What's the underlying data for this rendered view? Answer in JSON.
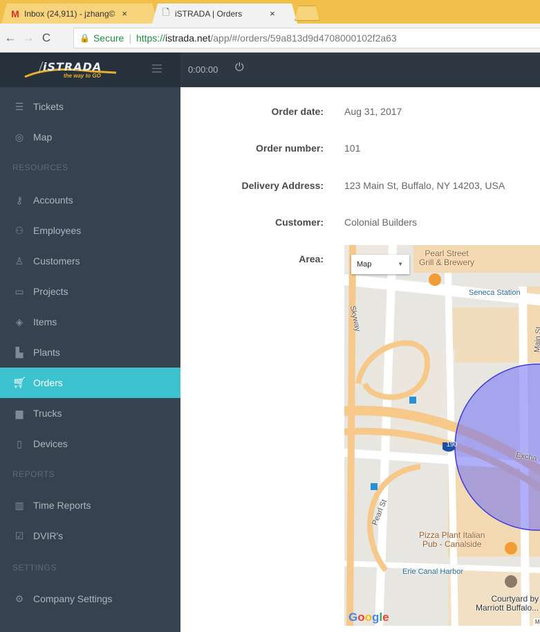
{
  "browser": {
    "tabs": [
      {
        "icon": "gmail-icon",
        "title": "Inbox (24,911) - jzhang©",
        "close": "×"
      },
      {
        "icon": "page-icon",
        "title": "iSTRADA | Orders",
        "close": "×"
      }
    ],
    "secure_label": "Secure",
    "url": {
      "scheme": "https://",
      "host": "istrada.net",
      "path": "/app/#/orders/59a813d9d4708000102f2a63"
    }
  },
  "app": {
    "logo_text": "iSTRADA",
    "logo_tagline": "the way to GO",
    "timer": "0:00:00"
  },
  "sidebar": {
    "items": [
      {
        "label": "Tickets",
        "icon": "layers-icon"
      },
      {
        "label": "Map",
        "icon": "map-pin-icon"
      },
      {
        "label": "Accounts",
        "icon": "key-icon"
      },
      {
        "label": "Employees",
        "icon": "users-icon"
      },
      {
        "label": "Customers",
        "icon": "user-icon"
      },
      {
        "label": "Projects",
        "icon": "folder-icon"
      },
      {
        "label": "Items",
        "icon": "box-icon"
      },
      {
        "label": "Plants",
        "icon": "factory-icon"
      },
      {
        "label": "Orders",
        "icon": "cart-icon",
        "active": true
      },
      {
        "label": "Trucks",
        "icon": "truck-icon"
      },
      {
        "label": "Devices",
        "icon": "phone-icon"
      },
      {
        "label": "Time Reports",
        "icon": "bar-chart-icon"
      },
      {
        "label": "DVIR's",
        "icon": "checkbox-icon"
      },
      {
        "label": "Company Settings",
        "icon": "gear-icon"
      }
    ],
    "sections": [
      "RESOURCES",
      "REPORTS",
      "SETTINGS"
    ]
  },
  "order": {
    "date_label": "Order date:",
    "date_value": "Aug 31, 2017",
    "number_label": "Order number:",
    "number_value": "101",
    "address_label": "Delivery Address:",
    "address_value": "123 Main St, Buffalo, NY 14203, USA",
    "customer_label": "Customer:",
    "customer_value": "Colonial Builders",
    "area_label": "Area:"
  },
  "map": {
    "type_selected": "Map",
    "labels": {
      "pearl_street_grill": "Pearl Street\nGrill & Brewery",
      "seneca_station": "Seneca Station",
      "skyway": "Skyway",
      "main_st": "Main St",
      "exchange": "Excha",
      "pearl_st": "Pearl St",
      "interstate": "190",
      "pizza_plant": "Pizza Plant Italian\nPub - Canalside",
      "erie_canal": "Erie Canal Harbor",
      "courtyard": "Courtyard by\nMarriott Buffalo..."
    },
    "attribution": "Ma",
    "circle_color": "#6e6ef5"
  }
}
